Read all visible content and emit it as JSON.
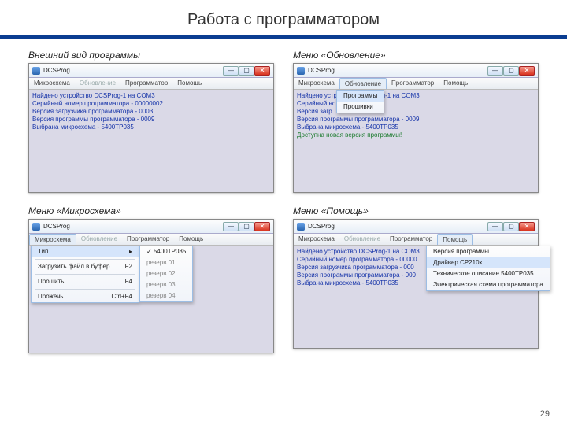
{
  "slide": {
    "title": "Работа с программатором",
    "page_number": "29"
  },
  "captions": {
    "main": "Внешний вид программы",
    "update": "Меню «Обновление»",
    "chip": "Меню «Микросхема»",
    "help": "Меню «Помощь»"
  },
  "app_common": {
    "title": "DCSProg",
    "menus": [
      "Микросхема",
      "Обновление",
      "Программатор",
      "Помощь"
    ]
  },
  "client_lines": {
    "l1": "Найдено устройство DCSProg-1 на COM3",
    "l2": "Серийный номер программатора - 00000002",
    "l3": "Версия загрузчика программатора - 0003",
    "l4": "Версия программы программатора - 0009",
    "l5": "Выбрана микросхема - 5400ТР035",
    "l6_green": "Доступна новая версия программы!",
    "l2short": "Серийный но",
    "l3short": "Версия загр",
    "l2half": "Серийный номер программатора - 00000",
    "l3half": "Версия загрузчика программатора - 000",
    "l4half": "Версия программы программатора - 000"
  },
  "update_menu": {
    "item1": "Программы",
    "item2": "Прошивки"
  },
  "chip_menu": {
    "i1": "Тип",
    "i1_sub_sel": "5400ТР035",
    "i2": "Загрузить файл в буфер",
    "i2_key": "F2",
    "i3": "Прошить",
    "i3_key": "F4",
    "i4": "Прожечь",
    "i4_key": "Ctrl+F4",
    "sub_r1": "резерв 01",
    "sub_r2": "резерв 02",
    "sub_r3": "резерв 03",
    "sub_r4": "резерв 04"
  },
  "help_menu": {
    "h1": "Версия программы",
    "h2": "Драйвер CP210x",
    "h3": "Техническое описание 5400ТР035",
    "h4": "Электрическая схема программатора"
  }
}
